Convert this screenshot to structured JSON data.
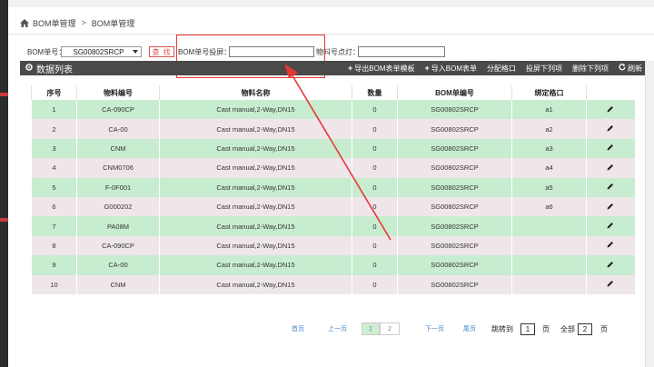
{
  "breadcrumb": {
    "root": "BOM单管理",
    "separator": ">",
    "current": "BOM单管理"
  },
  "filters": {
    "bom_label": "BOM单号：",
    "bom_value": "SG00802SRCP",
    "search_label": "查 找",
    "project_label": "BOM单号投屏：",
    "project_value": "",
    "light_label": "物料号点灯：",
    "light_value": ""
  },
  "toolbar": {
    "title": "数据列表",
    "export": "导出BOM表单模板",
    "import": "导入BOM表单",
    "assign": "分配格口",
    "project_down": "投屏下列项",
    "delete_down": "删除下列项",
    "refresh": "刷新"
  },
  "table": {
    "headers": [
      "序号",
      "物料编号",
      "物料名称",
      "数量",
      "BOM单编号",
      "绑定格口",
      ""
    ],
    "rows": [
      [
        "1",
        "CA-090CP",
        "Cast manual,2-Way,DN15",
        "0",
        "SG00802SRCP",
        "a1"
      ],
      [
        "2",
        "CA-00",
        "Cast manual,2-Way,DN15",
        "0",
        "SG00802SRCP",
        "a2"
      ],
      [
        "3",
        "CNM",
        "Cast manual,2-Way,DN15",
        "0",
        "SG00802SRCP",
        "a3"
      ],
      [
        "4",
        "CNM0706",
        "Cast manual,2-Way,DN15",
        "0",
        "SG00802SRCP",
        "a4"
      ],
      [
        "5",
        "F-0F001",
        "Cast manual,2-Way,DN15",
        "0",
        "SG00802SRCP",
        "a5"
      ],
      [
        "6",
        "G000202",
        "Cast manual,2-Way,DN15",
        "0",
        "SG00802SRCP",
        "a6"
      ],
      [
        "7",
        "PA08M",
        "Cast manual,2-Way,DN15",
        "0",
        "SG00802SRCP",
        ""
      ],
      [
        "8",
        "CA-090CP",
        "Cast manual,2-Way,DN15",
        "0",
        "SG00802SRCP",
        ""
      ],
      [
        "9",
        "CA-00",
        "Cast manual,2-Way,DN15",
        "0",
        "SG00802SRCP",
        ""
      ],
      [
        "10",
        "CNM",
        "Cast manual,2-Way,DN15",
        "0",
        "SG00802SRCP",
        ""
      ]
    ]
  },
  "pager": {
    "first": "首页",
    "prev": "上一页",
    "page1": "1",
    "page2": "2",
    "next": "下一页",
    "last": "尾页",
    "jump_label": "跳转到",
    "jump_value": "1",
    "page_unit": "页",
    "total_label": "全部",
    "total_value": "2",
    "total_unit": "页"
  },
  "colors": {
    "accent_red": "#e53935",
    "row_green": "#c8eccf",
    "row_pink": "#efe6ea",
    "toolbar_bg": "#4a4a4a"
  }
}
